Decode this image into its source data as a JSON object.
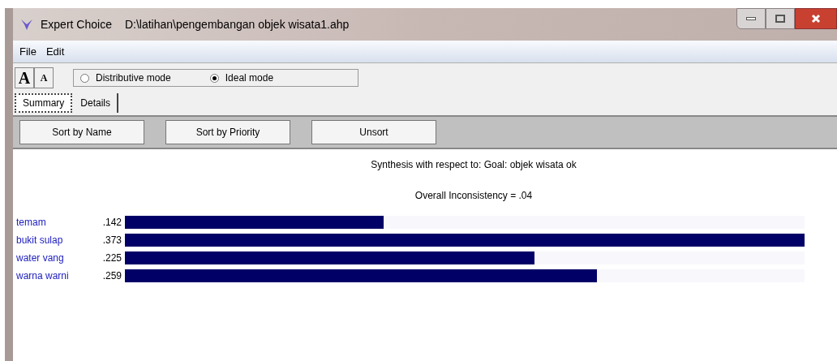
{
  "window": {
    "app": "Expert Choice",
    "file": "D:\\latihan\\pengembangan objek wisata1.ahp"
  },
  "menu": [
    "File",
    "Edit"
  ],
  "toolbar": {
    "font_buttons": [
      "A",
      "A"
    ],
    "modes": [
      {
        "label": "Distributive mode",
        "selected": false
      },
      {
        "label": "Ideal mode",
        "selected": true
      }
    ]
  },
  "tabs": [
    {
      "label": "Summary",
      "selected": true
    },
    {
      "label": "Details",
      "selected": false
    }
  ],
  "buttons": [
    "Sort by Name",
    "Sort by Priority",
    "Unsort"
  ],
  "synthesis_title": "Synthesis with respect to: Goal: objek wisata ok",
  "inconsistency": "Overall Inconsistency = .04",
  "alternatives": [
    {
      "name": "temam",
      "value": ".142",
      "level": 0.381
    },
    {
      "name": "bukit sulap",
      "value": ".373",
      "level": 1
    },
    {
      "name": "water vang",
      "value": ".225",
      "level": 0.603
    },
    {
      "name": "warna warni",
      "value": ".259",
      "level": 0.694
    }
  ]
}
